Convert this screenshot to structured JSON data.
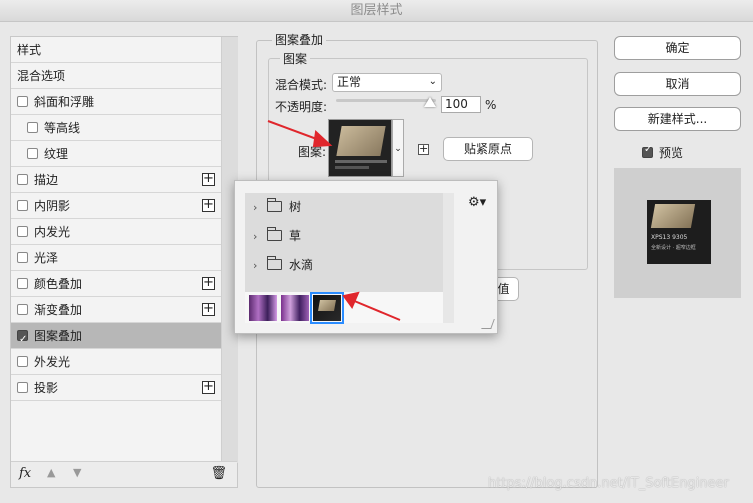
{
  "window": {
    "title": "图层样式"
  },
  "styles": {
    "header": "样式",
    "blend_options": "混合选项",
    "items": [
      {
        "label": "斜面和浮雕",
        "checked": false,
        "indent": false,
        "plus": false
      },
      {
        "label": "等高线",
        "checked": false,
        "indent": true,
        "plus": false
      },
      {
        "label": "纹理",
        "checked": false,
        "indent": true,
        "plus": false
      },
      {
        "label": "描边",
        "checked": false,
        "indent": false,
        "plus": true
      },
      {
        "label": "内阴影",
        "checked": false,
        "indent": false,
        "plus": true
      },
      {
        "label": "内发光",
        "checked": false,
        "indent": false,
        "plus": false
      },
      {
        "label": "光泽",
        "checked": false,
        "indent": false,
        "plus": false
      },
      {
        "label": "颜色叠加",
        "checked": false,
        "indent": false,
        "plus": true
      },
      {
        "label": "渐变叠加",
        "checked": false,
        "indent": false,
        "plus": true
      },
      {
        "label": "图案叠加",
        "checked": true,
        "indent": false,
        "plus": false,
        "active": true
      },
      {
        "label": "外发光",
        "checked": false,
        "indent": false,
        "plus": false
      },
      {
        "label": "投影",
        "checked": false,
        "indent": false,
        "plus": true
      }
    ],
    "footer": {
      "fx_label": "fx"
    }
  },
  "pattern_overlay": {
    "group_title": "图案叠加",
    "subgroup_title": "图案",
    "blend_mode_label": "混合模式:",
    "blend_mode_value": "正常",
    "opacity_label": "不透明度:",
    "opacity_value": "100",
    "opacity_unit": "%",
    "opacity_level": 1.0,
    "pattern_label": "图案:",
    "snap_origin_button": "贴紧原点",
    "hidden_button_fragment": "值"
  },
  "actions": {
    "ok": "确定",
    "cancel": "取消",
    "new_style": "新建样式...",
    "preview_label": "预览",
    "preview_checked": true
  },
  "pattern_picker": {
    "folders": [
      {
        "name": "树"
      },
      {
        "name": "草"
      },
      {
        "name": "水滴"
      }
    ],
    "swatches": [
      {
        "name": "purple-pattern-1",
        "selected": false
      },
      {
        "name": "purple-pattern-2",
        "selected": false
      },
      {
        "name": "laptop-pattern",
        "selected": true
      }
    ]
  },
  "preview_thumb_text": {
    "line1": "XPS13 9305",
    "line2": "全新设计 · 超窄边框"
  },
  "watermark": "https://blog.csdn.net/IT_SoftEngineer",
  "colors": {
    "accent": "#2a8cff",
    "annotation_arrow": "#e0262c",
    "active_row": "#b7b7b7"
  }
}
